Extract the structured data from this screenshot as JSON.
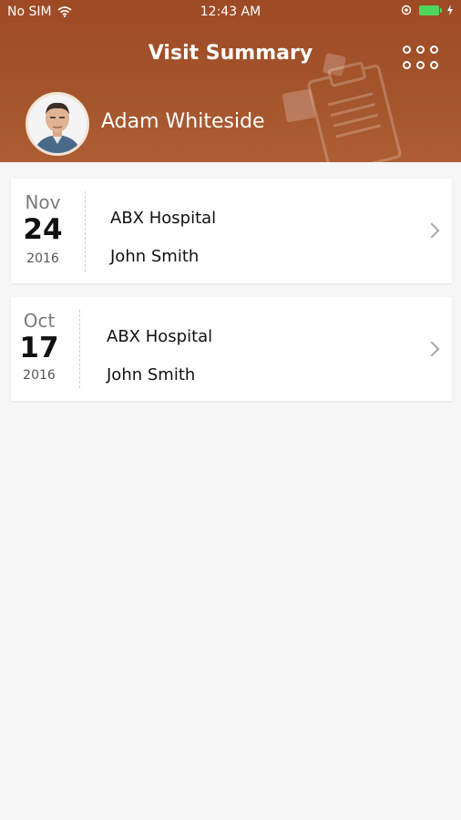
{
  "status_bar": {
    "carrier": "No SIM",
    "time": "12:43 AM"
  },
  "header": {
    "title": "Visit Summary",
    "menu_icon": "grid-dots-icon",
    "background_color": "#a3522b"
  },
  "user": {
    "name": "Adam Whiteside"
  },
  "visits": [
    {
      "month": "Nov",
      "day": "24",
      "year": "2016",
      "hospital": "ABX Hospital",
      "doctor": "John Smith"
    },
    {
      "month": "Oct",
      "day": "17",
      "year": "2016",
      "hospital": "ABX Hospital",
      "doctor": "John Smith"
    }
  ]
}
